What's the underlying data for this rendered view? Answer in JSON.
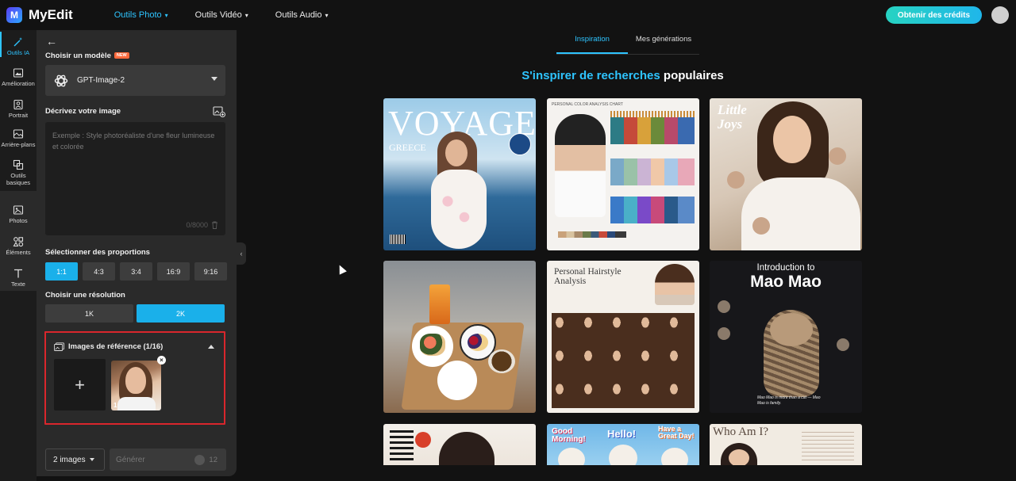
{
  "app": {
    "name": "MyEdit"
  },
  "nav": [
    {
      "label": "Outils Photo",
      "active": true
    },
    {
      "label": "Outils Vidéo",
      "active": false
    },
    {
      "label": "Outils Audio",
      "active": false
    }
  ],
  "header": {
    "credits_button": "Obtenir des crédits"
  },
  "rail": {
    "items": [
      {
        "label": "Outils IA"
      },
      {
        "label": "Amélioration"
      },
      {
        "label": "Portrait"
      },
      {
        "label": "Arrière-plans"
      },
      {
        "label": "Outils basiques"
      },
      {
        "label": "Photos"
      },
      {
        "label": "Éléments"
      },
      {
        "label": "Texte"
      }
    ]
  },
  "panel": {
    "model_label": "Choisir un modèle",
    "new_badge": "NEW",
    "model_value": "GPT-Image-2",
    "describe_label": "Décrivez votre image",
    "prompt_placeholder": "Exemple : Style photoréaliste d'une fleur lumineuse et colorée",
    "char_counter": "0/8000",
    "ratio_label": "Sélectionner des proportions",
    "ratios": [
      "1:1",
      "4:3",
      "3:4",
      "16:9",
      "9:16"
    ],
    "resolution_label": "Choisir une résolution",
    "resolutions": [
      "1K",
      "2K"
    ],
    "reference_label": "Images de référence (1/16)",
    "reference_add": "+",
    "reference_thumb_number": "1",
    "reference_remove": "×",
    "image_count": "2 images",
    "generate_label": "Générer",
    "generate_cost": "12",
    "collapse": "‹"
  },
  "main": {
    "tabs": [
      {
        "label": "Inspiration",
        "active": true
      },
      {
        "label": "Mes générations",
        "active": false
      }
    ],
    "heading_part1": "S'inspirer de recherches",
    "heading_part2": "populaires",
    "cards": {
      "voyage_title": "VOYAGE",
      "voyage_sub": "GREECE",
      "color_chart_title": "PERSONAL COLOR ANALYSIS CHART",
      "little_joys": "Little Joys",
      "hairstyle_title": "Personal Hairstyle Analysis",
      "mao_title_1": "Introduction to",
      "mao_title_2": "Mao Mao",
      "mao_footer": "Mao Mao is more than a cat — Mao Mao is family.",
      "hello_1": "Good Morning!",
      "hello_2": "Hello!",
      "hello_3": "Have a Great Day!",
      "who_am_i": "Who Am I?"
    }
  },
  "colors": {
    "accent": "#2ec4ff",
    "credits_gradient_start": "#27d3c2",
    "credits_gradient_end": "#1fb6ea",
    "reference_border": "#d9262c"
  }
}
